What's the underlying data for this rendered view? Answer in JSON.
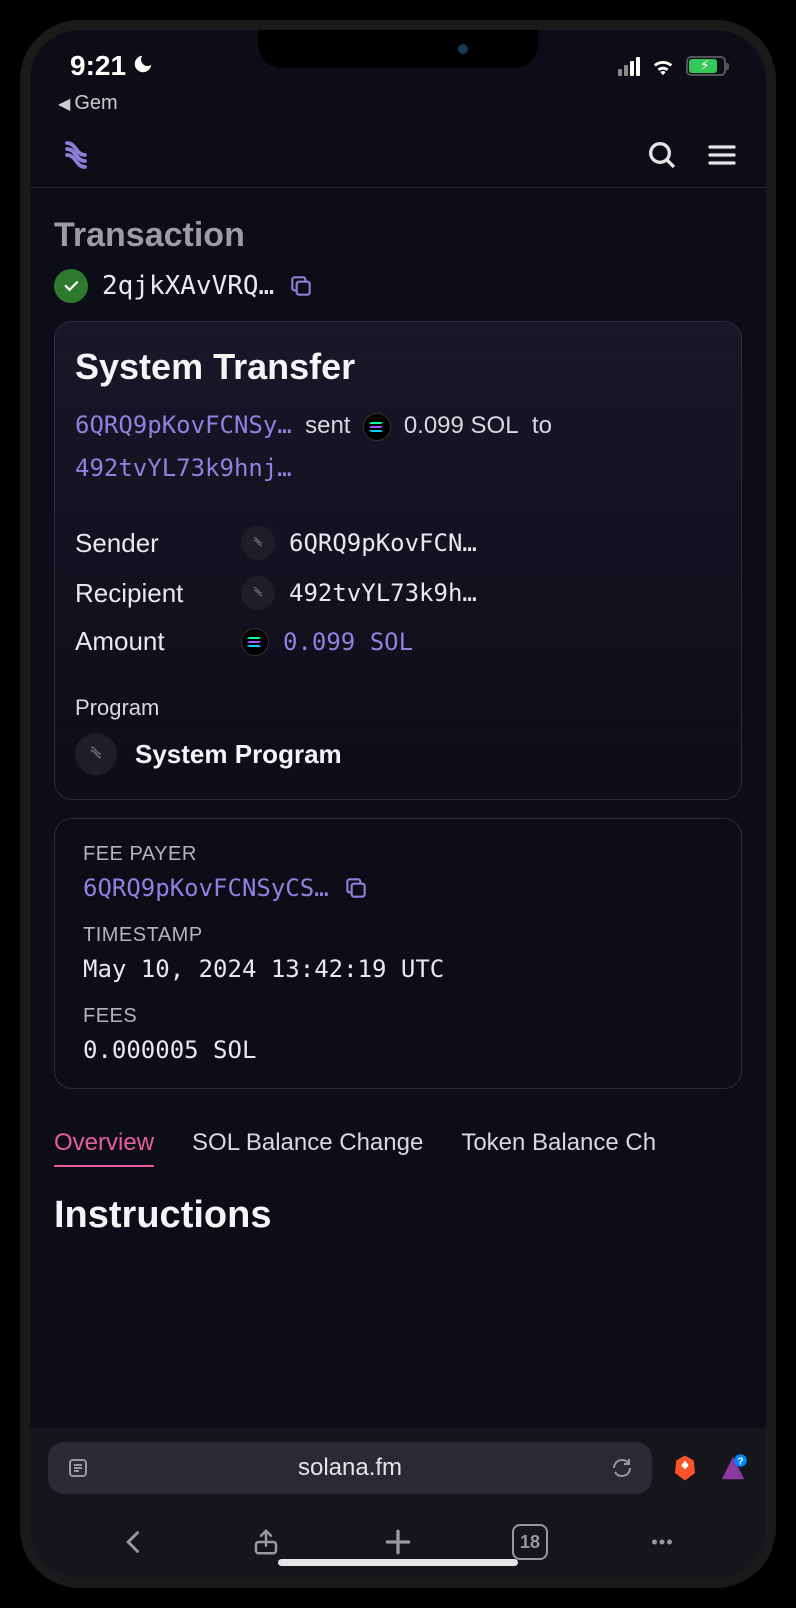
{
  "status_bar": {
    "time": "9:21",
    "back_app": "Gem"
  },
  "page": {
    "title": "Transaction",
    "tx_hash": "2qjkXAvVRQ…"
  },
  "transfer": {
    "title": "System Transfer",
    "from": "6QRQ9pKovFCNSy…",
    "verb": "sent",
    "amount": "0.099 SOL",
    "to_word": "to",
    "to": "492tvYL73k9hnj…",
    "rows": {
      "sender_label": "Sender",
      "sender_value": "6QRQ9pKovFCN…",
      "recipient_label": "Recipient",
      "recipient_value": "492tvYL73k9h…",
      "amount_label": "Amount",
      "amount_value": "0.099 SOL"
    },
    "program_label": "Program",
    "program_value": "System Program"
  },
  "meta": {
    "fee_payer_label": "FEE PAYER",
    "fee_payer_value": "6QRQ9pKovFCNSyCS…",
    "timestamp_label": "TIMESTAMP",
    "timestamp_value": "May 10, 2024 13:42:19 UTC",
    "fees_label": "FEES",
    "fees_value": "0.000005 SOL"
  },
  "tabs": {
    "overview": "Overview",
    "sol_balance": "SOL Balance Change",
    "token_balance": "Token Balance Ch"
  },
  "instructions_title": "Instructions",
  "browser": {
    "url": "solana.fm",
    "tab_count": "18"
  }
}
